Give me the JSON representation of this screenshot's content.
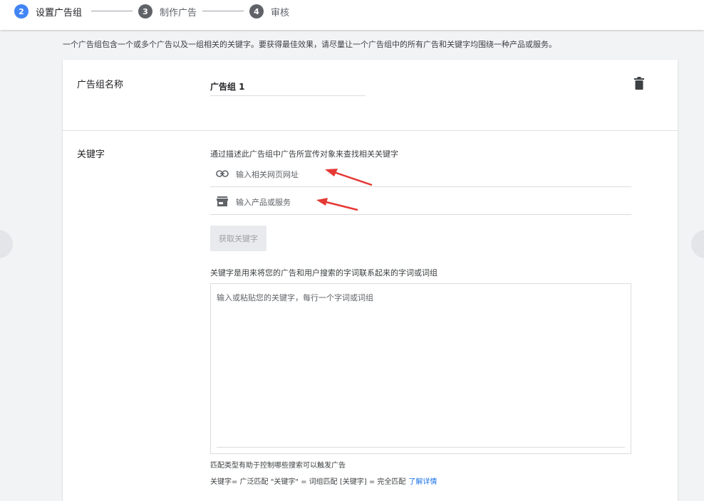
{
  "stepper": {
    "steps": [
      {
        "num": "2",
        "label": "设置广告组",
        "active": true
      },
      {
        "num": "3",
        "label": "制作广告",
        "active": false
      },
      {
        "num": "4",
        "label": "审核",
        "active": false
      }
    ]
  },
  "intro": "一个广告组包含一个或多个广告以及一组相关的关键字。要获得最佳效果，请尽量让一个广告组中的所有广告和关键字均围绕一种产品或服务。",
  "ad_group": {
    "label": "广告组名称",
    "value": "广告组 1"
  },
  "keywords": {
    "label": "关键字",
    "description": "通过描述此广告组中广告所宣传对象来查找相关关键字",
    "url_placeholder": "输入相关网页网址",
    "product_placeholder": "输入产品或服务",
    "get_button": "获取关键字",
    "help": "关键字是用来将您的广告和用户搜索的字词联系起来的字词或词组",
    "textarea_placeholder": "输入或粘贴您的关键字，每行一个字词或词组",
    "match_info": "匹配类型有助于控制哪些搜索可以触发广告",
    "match_types": "关键字= 广泛匹配 \"关键字\" = 词组匹配 [关键字] = 完全匹配",
    "learn_more": "了解详情"
  },
  "colors": {
    "accent": "#4285f4",
    "link": "#1a73e8",
    "annotation_arrow": "#e53935"
  },
  "icons": [
    "link-icon",
    "store-icon",
    "trash-icon"
  ]
}
